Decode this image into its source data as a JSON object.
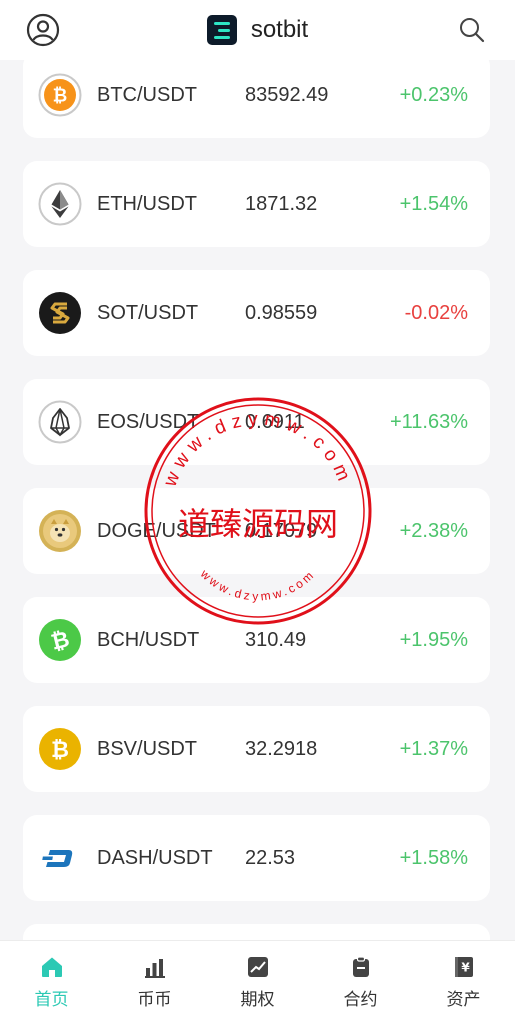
{
  "header": {
    "brand": "sotbit",
    "icons": [
      "user-icon",
      "sotbit-logo-icon",
      "search-icon"
    ]
  },
  "markets": [
    {
      "pair": "BTC/USDT",
      "price": "83592.49",
      "change": "+0.23%",
      "direction": "up",
      "icon": "btc-icon"
    },
    {
      "pair": "ETH/USDT",
      "price": "1871.32",
      "change": "+1.54%",
      "direction": "up",
      "icon": "eth-icon"
    },
    {
      "pair": "SOT/USDT",
      "price": "0.98559",
      "change": "-0.02%",
      "direction": "down",
      "icon": "sot-icon"
    },
    {
      "pair": "EOS/USDT",
      "price": "0.6911",
      "change": "+11.63%",
      "direction": "up",
      "icon": "eos-icon"
    },
    {
      "pair": "DOGE/USDT",
      "price": "0.17079",
      "change": "+2.38%",
      "direction": "up",
      "icon": "doge-icon"
    },
    {
      "pair": "BCH/USDT",
      "price": "310.49",
      "change": "+1.95%",
      "direction": "up",
      "icon": "bch-icon"
    },
    {
      "pair": "BSV/USDT",
      "price": "32.2918",
      "change": "+1.37%",
      "direction": "up",
      "icon": "bsv-icon"
    },
    {
      "pair": "DASH/USDT",
      "price": "22.53",
      "change": "+1.58%",
      "direction": "up",
      "icon": "dash-icon"
    }
  ],
  "watermark": {
    "title": "道臻源码网",
    "url": "www.dzymw.com",
    "color": "#e0101a"
  },
  "tabs": [
    {
      "label": "首页",
      "icon": "home-icon",
      "active": true
    },
    {
      "label": "币币",
      "icon": "bar-chart-icon",
      "active": false
    },
    {
      "label": "期权",
      "icon": "trend-chart-icon",
      "active": false
    },
    {
      "label": "合约",
      "icon": "clipboard-icon",
      "active": false
    },
    {
      "label": "资产",
      "icon": "wallet-icon",
      "active": false
    }
  ],
  "colors": {
    "up": "#4cc46c",
    "down": "#e8413f",
    "accent": "#2cc9b4",
    "background": "#f5f5f7"
  }
}
